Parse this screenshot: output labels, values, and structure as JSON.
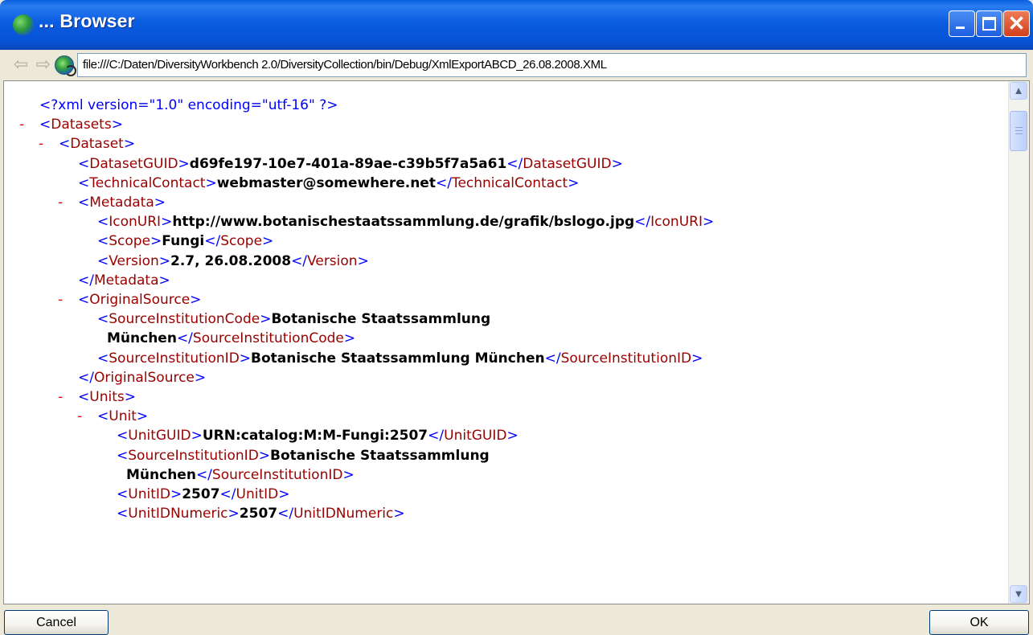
{
  "window": {
    "title": "... Browser",
    "close_symbol": "✕"
  },
  "address": {
    "back_symbol": "⇦",
    "forward_symbol": "⇨",
    "url": "file:///C:/Daten/DiversityWorkbench 2.0/DiversityCollection/bin/Debug/XmlExportABCD_26.08.2008.XML"
  },
  "xml_lines": [
    {
      "indent": 0,
      "minus": "",
      "pi": "<?xml version=\"1.0\" encoding=\"utf-16\" ?>"
    },
    {
      "indent": 0,
      "minus": "-",
      "open_tag": "Datasets"
    },
    {
      "indent": 1,
      "minus": "-",
      "open_tag": "Dataset"
    },
    {
      "indent": 2,
      "minus": "",
      "open_tag": "DatasetGUID",
      "value": "d69fe197-10e7-401a-89ae-c39b5f7a5a61",
      "close_tag": "DatasetGUID"
    },
    {
      "indent": 2,
      "minus": "",
      "open_tag": "TechnicalContact",
      "value": "webmaster@somewhere.net",
      "close_tag": "TechnicalContact"
    },
    {
      "indent": 2,
      "minus": "-",
      "open_tag": "Metadata"
    },
    {
      "indent": 3,
      "minus": "",
      "open_tag": "IconURI",
      "value": "http://www.botanischestaatssammlung.de/grafik/bslogo.jpg",
      "close_tag": "IconURI"
    },
    {
      "indent": 3,
      "minus": "",
      "open_tag": "Scope",
      "value": "Fungi",
      "close_tag": "Scope"
    },
    {
      "indent": 3,
      "minus": "",
      "open_tag": "Version",
      "value": "2.7, 26.08.2008",
      "close_tag": "Version"
    },
    {
      "indent": 2,
      "minus": "",
      "end_tag": "Metadata"
    },
    {
      "indent": 2,
      "minus": "-",
      "open_tag": "OriginalSource"
    },
    {
      "indent": 3,
      "minus": "",
      "open_tag": "SourceInstitutionCode",
      "value": "Botanische Staatssammlung"
    },
    {
      "indent": 3.5,
      "minus": "",
      "value": "München",
      "close_tag": "SourceInstitutionCode"
    },
    {
      "indent": 3,
      "minus": "",
      "open_tag": "SourceInstitutionID",
      "value": "Botanische Staatssammlung München",
      "close_tag": "SourceInstitutionID"
    },
    {
      "indent": 2,
      "minus": "",
      "end_tag": "OriginalSource"
    },
    {
      "indent": 2,
      "minus": "-",
      "open_tag": "Units"
    },
    {
      "indent": 3,
      "minus": "-",
      "open_tag": "Unit"
    },
    {
      "indent": 4,
      "minus": "",
      "open_tag": "UnitGUID",
      "value": "URN:catalog:M:M-Fungi:2507",
      "close_tag": "UnitGUID"
    },
    {
      "indent": 4,
      "minus": "",
      "open_tag": "SourceInstitutionID",
      "value": "Botanische Staatssammlung"
    },
    {
      "indent": 4.5,
      "minus": "",
      "value": "München",
      "close_tag": "SourceInstitutionID"
    },
    {
      "indent": 4,
      "minus": "",
      "open_tag": "UnitID",
      "value": "2507",
      "close_tag": "UnitID"
    },
    {
      "indent": 4,
      "minus": "",
      "open_tag": "UnitIDNumeric",
      "value": "2507",
      "close_tag": "UnitIDNumeric"
    }
  ],
  "scrollbar": {
    "up_symbol": "▲",
    "down_symbol": "▼"
  },
  "buttons": {
    "cancel_label": "Cancel",
    "ok_label": "OK"
  }
}
